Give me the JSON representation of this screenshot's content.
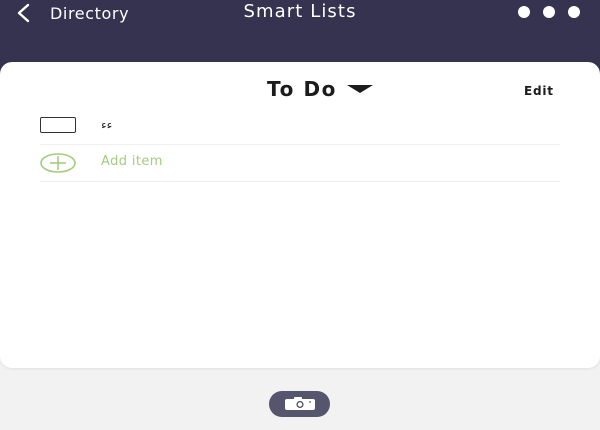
{
  "header": {
    "back_label": "Directory",
    "title": "Smart Lists",
    "back_icon": "chevron-left-icon",
    "more_icon": "more-dots-icon",
    "background": "#35334f"
  },
  "list": {
    "title": "To Do",
    "edit_label": "Edit",
    "items": [
      {
        "text": "ءء",
        "checked": false
      }
    ],
    "add_item_label": "Add item",
    "accent": "#a5cc80"
  },
  "footer": {
    "camera_icon": "camera-icon",
    "button_color": "#55556e"
  }
}
